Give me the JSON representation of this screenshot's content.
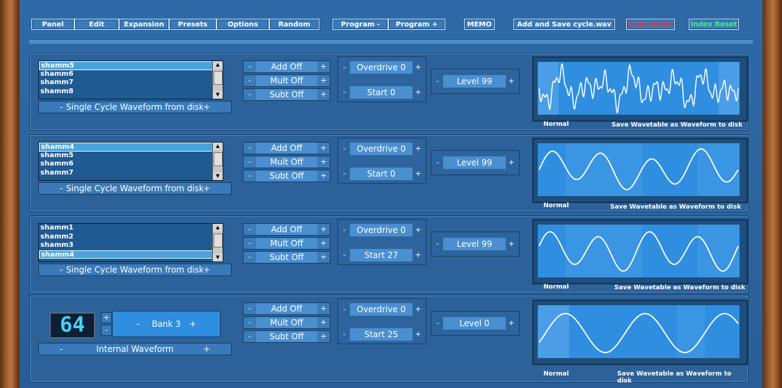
{
  "toolbar": {
    "buttons": [
      "Panel",
      "Edit",
      "Expansion",
      "Presets",
      "Options",
      "Random",
      "Program  -",
      "Program  +",
      "MEMO",
      "Add and Save cycle.wav",
      "Scan Folder",
      "Index Reset"
    ]
  },
  "colors": {
    "scan_folder": "#ff2a2a",
    "index_reset": "#3ff07a",
    "panel": "#2c6199",
    "display": "#2f8ee0"
  },
  "panels": [
    {
      "list_items": [
        "shamm5",
        "shamm6",
        "shamm7",
        "shamm8"
      ],
      "selected": 0,
      "waveform_label": "Single Cycle Waveform from disk",
      "ops": [
        "Add Off",
        "Mult Off",
        "Subt Off"
      ],
      "overdrive": "Overdrive 0",
      "start": "Start 0",
      "level": "Level 99",
      "mode": "Normal",
      "save_label": "Save Wavetable as Waveform to disk"
    },
    {
      "list_items": [
        "shamm4",
        "shamm5",
        "shamm6",
        "shamm7"
      ],
      "selected": 0,
      "waveform_label": "Single Cycle Waveform from disk",
      "ops": [
        "Add Off",
        "Mult Off",
        "Subt Off"
      ],
      "overdrive": "Overdrive 0",
      "start": "Start 0",
      "level": "Level 99",
      "mode": "Normal",
      "save_label": "Save Wavetable as Waveform to disk"
    },
    {
      "list_items": [
        "shamm1",
        "shamm2",
        "shamm3",
        "shamm4"
      ],
      "selected": 3,
      "waveform_label": "Single Cycle Waveform from disk",
      "ops": [
        "Add Off",
        "Mult Off",
        "Subt Off"
      ],
      "overdrive": "Overdrive 0",
      "start": "Start 27",
      "level": "Level 99",
      "mode": "Normal",
      "save_label": "Save Wavetable as Waveform to disk"
    },
    {
      "lcd": "64",
      "bank": "Bank 3",
      "waveform_label": "Internal Waveform",
      "ops": [
        "Add Off",
        "Mult Off",
        "Subt Off"
      ],
      "overdrive": "Overdrive 0",
      "start": "Start 25",
      "level": "Level 0",
      "mode": "Normal",
      "save_label": "Save Wavetable as Waveform to disk"
    }
  ],
  "symbols": {
    "minus": "-",
    "plus": "+",
    "up": "▲",
    "down": "▼"
  }
}
